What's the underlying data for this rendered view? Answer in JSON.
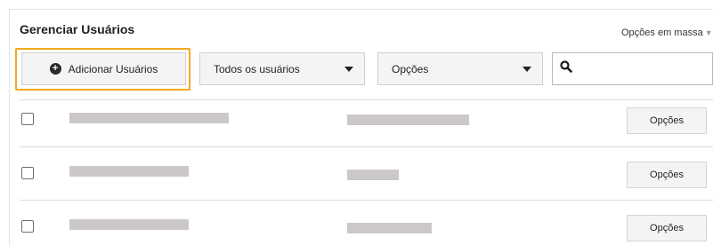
{
  "header": {
    "title": "Gerenciar Usuários",
    "bulk_options_label": "Opções em massa"
  },
  "toolbar": {
    "add_users_label": "Adicionar Usuários",
    "users_filter_selected": "Todos os usuários",
    "options_selected": "Opções",
    "search_placeholder": ""
  },
  "rows": [
    {
      "options_label": "Opções"
    },
    {
      "options_label": "Opções"
    },
    {
      "options_label": "Opções"
    }
  ],
  "colors": {
    "highlight": "#f2a91c",
    "placeholder_bar": "#cdc8c8"
  }
}
